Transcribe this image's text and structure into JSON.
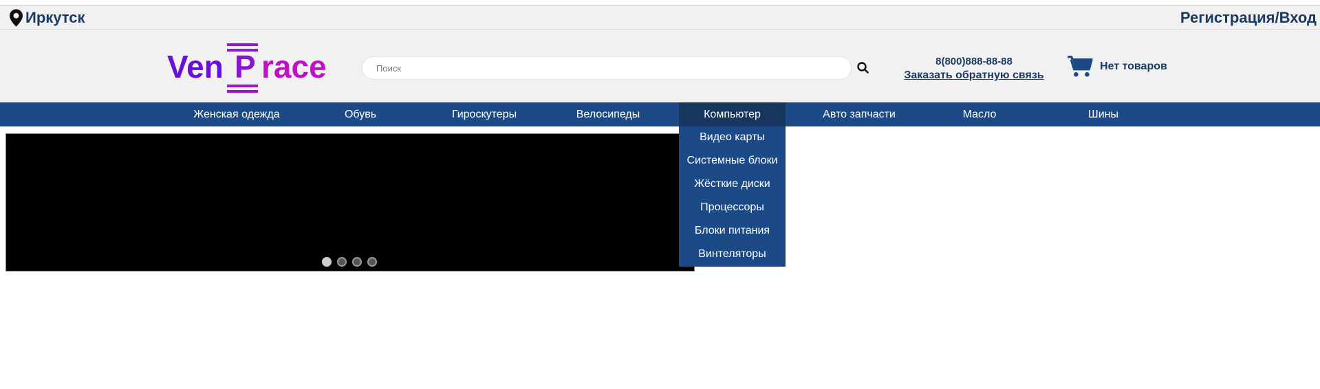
{
  "topbar": {
    "city": "Иркутск",
    "auth_link": "Регистрация/Вход"
  },
  "logo": {
    "part1": "Ven",
    "part2": "P",
    "part3": "race",
    "colors": [
      "#6b10d8",
      "#c110c6"
    ]
  },
  "search": {
    "placeholder": "Поиск",
    "value": ""
  },
  "contact": {
    "phone": "8(800)888-88-88",
    "callback_link": "Заказать обратную связь"
  },
  "cart": {
    "label": "Нет товаров",
    "icon": "cart-icon"
  },
  "nav": {
    "items": [
      {
        "label": "Женская одежда"
      },
      {
        "label": "Обувь"
      },
      {
        "label": "Гироскутеры"
      },
      {
        "label": "Велосипеды"
      },
      {
        "label": "Компьютер"
      },
      {
        "label": "Авто запчасти"
      },
      {
        "label": "Масло"
      },
      {
        "label": "Шины"
      }
    ],
    "active_index": 4
  },
  "dropdown": {
    "items": [
      {
        "label": "Видео карты"
      },
      {
        "label": "Системные блоки"
      },
      {
        "label": "Жёсткие диски"
      },
      {
        "label": "Процессоры"
      },
      {
        "label": "Блоки питания"
      },
      {
        "label": "Винтеляторы"
      }
    ]
  },
  "slider": {
    "slide_count": 4,
    "active_slide": 1
  },
  "colors": {
    "brand_dark": "#1b3b63",
    "nav_bg": "#1c4a86",
    "nav_active": "#16365e",
    "header_bg": "#f1f1f1"
  }
}
